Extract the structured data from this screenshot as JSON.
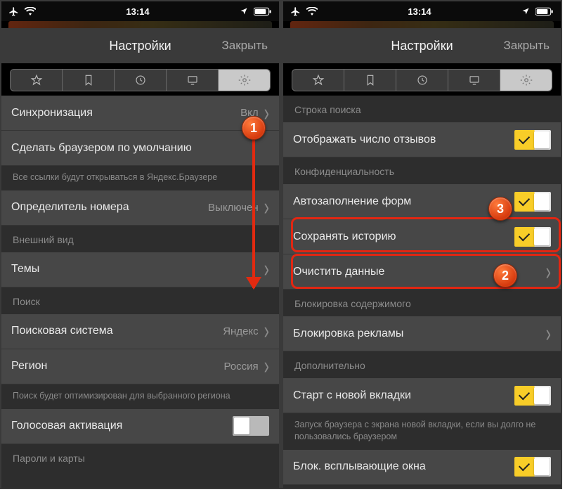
{
  "screens": [
    {
      "statusbar": {
        "time": "13:14"
      },
      "header": {
        "title": "Настройки",
        "close": "Закрыть"
      },
      "rows": {
        "sync": {
          "label": "Синхронизация",
          "value": "Вкл"
        },
        "default_browser": {
          "label": "Сделать браузером по умолчанию"
        },
        "default_browser_footer": "Все ссылки будут открываться в Яндекс.Браузере",
        "caller_id": {
          "label": "Определитель номера",
          "value": "Выключен"
        },
        "section_appearance": "Внешний вид",
        "themes": {
          "label": "Темы"
        },
        "section_search": "Поиск",
        "search_engine": {
          "label": "Поисковая система",
          "value": "Яндекс"
        },
        "region": {
          "label": "Регион",
          "value": "Россия"
        },
        "region_footer": "Поиск будет оптимизирован для выбранного региона",
        "voice": {
          "label": "Голосовая активация"
        },
        "section_passwords": "Пароли и карты"
      }
    },
    {
      "statusbar": {
        "time": "13:14"
      },
      "header": {
        "title": "Настройки",
        "close": "Закрыть"
      },
      "rows": {
        "section_searchbar": "Строка поиска",
        "reviews_count": {
          "label": "Отображать число отзывов"
        },
        "section_privacy": "Конфиденциальность",
        "autofill": {
          "label": "Автозаполнение форм"
        },
        "save_history": {
          "label": "Сохранять историю"
        },
        "clear_data": {
          "label": "Очистить данные"
        },
        "section_content_block": "Блокировка содержимого",
        "adblock": {
          "label": "Блокировка рекламы"
        },
        "section_extra": "Дополнительно",
        "new_tab_start": {
          "label": "Старт с новой вкладки"
        },
        "new_tab_footer": "Запуск браузера с экрана новой вкладки, если вы долго не пользовались браузером",
        "popups": {
          "label": "Блок. всплывающие окна"
        }
      }
    }
  ],
  "markers": {
    "m1": "1",
    "m2": "2",
    "m3": "3"
  }
}
